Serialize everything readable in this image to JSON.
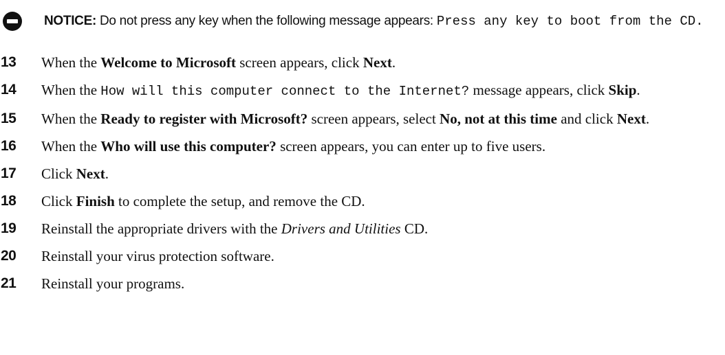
{
  "notice": {
    "icon": "notice-icon",
    "label": "NOTICE:",
    "text": " Do not press any key when the following message appears: ",
    "code": "Press any key to boot from the CD",
    "end": "."
  },
  "steps": [
    {
      "number": "13",
      "parts": [
        {
          "t": "When the "
        },
        {
          "t": "Welcome to Microsoft",
          "style": "b"
        },
        {
          "t": " screen appears, click "
        },
        {
          "t": "Next",
          "style": "b"
        },
        {
          "t": "."
        }
      ]
    },
    {
      "number": "14",
      "parts": [
        {
          "t": "When the "
        },
        {
          "t": "How will this computer connect to the Internet?",
          "style": "mono"
        },
        {
          "t": " message appears, click "
        },
        {
          "t": "Skip",
          "style": "b"
        },
        {
          "t": "."
        }
      ]
    },
    {
      "number": "15",
      "parts": [
        {
          "t": "When the "
        },
        {
          "t": "Ready to register with Microsoft?",
          "style": "b"
        },
        {
          "t": " screen appears, select "
        },
        {
          "t": "No, not at this time",
          "style": "b"
        },
        {
          "t": " and click "
        },
        {
          "t": "Next",
          "style": "b"
        },
        {
          "t": "."
        }
      ]
    },
    {
      "number": "16",
      "parts": [
        {
          "t": "When the "
        },
        {
          "t": "Who will use this computer?",
          "style": "b"
        },
        {
          "t": " screen appears, you can enter up to five users."
        }
      ]
    },
    {
      "number": "17",
      "parts": [
        {
          "t": "Click "
        },
        {
          "t": "Next",
          "style": "b"
        },
        {
          "t": "."
        }
      ]
    },
    {
      "number": "18",
      "parts": [
        {
          "t": "Click "
        },
        {
          "t": "Finish",
          "style": "b"
        },
        {
          "t": " to complete the setup, and remove the CD."
        }
      ]
    },
    {
      "number": "19",
      "parts": [
        {
          "t": "Reinstall the appropriate drivers with the "
        },
        {
          "t": "Drivers and Utilities",
          "style": "i"
        },
        {
          "t": " CD."
        }
      ]
    },
    {
      "number": "20",
      "parts": [
        {
          "t": "Reinstall your virus protection software."
        }
      ]
    },
    {
      "number": "21",
      "parts": [
        {
          "t": "Reinstall your programs."
        }
      ]
    }
  ]
}
